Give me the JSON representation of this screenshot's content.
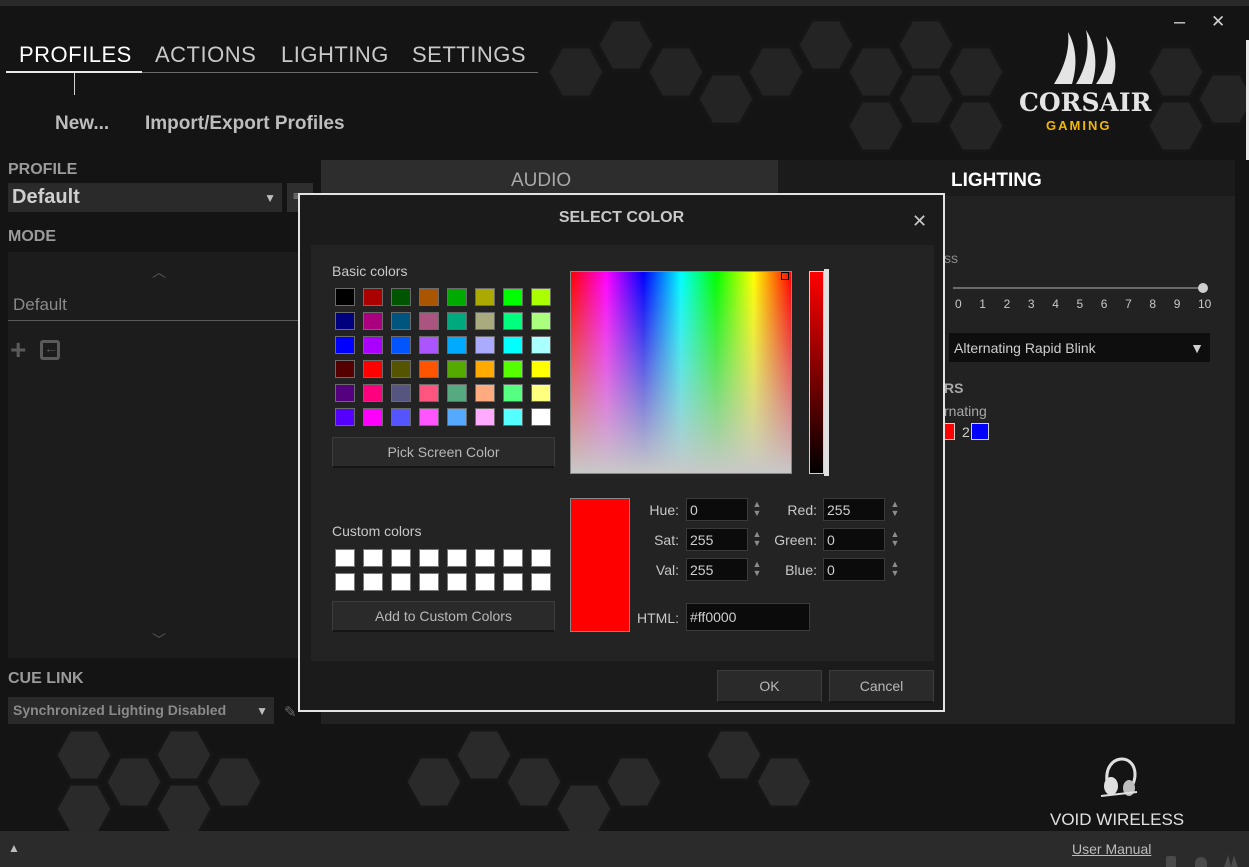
{
  "window": {
    "minimize_glyph": "–",
    "close_glyph": "✕"
  },
  "nav": {
    "tabs": [
      {
        "label": "PROFILES",
        "active": true
      },
      {
        "label": "ACTIONS",
        "active": false
      },
      {
        "label": "LIGHTING",
        "active": false
      },
      {
        "label": "SETTINGS",
        "active": false
      }
    ]
  },
  "profile_actions": {
    "new_label": "New...",
    "import_export_label": "Import/Export Profiles"
  },
  "brand": {
    "name": "CORSAIR",
    "sub": "GAMING",
    "accent": "#f2b705"
  },
  "left_panel": {
    "profile_label": "PROFILE",
    "profile_value": "Default",
    "mode_label": "MODE",
    "mode_item": "Default",
    "cue_link_label": "CUE LINK",
    "cue_link_value": "Synchronized Lighting Disabled"
  },
  "content": {
    "tab_audio": "AUDIO",
    "tab_lighting": "LIGHTING",
    "brightness_partial": "ss",
    "scale": [
      "0",
      "1",
      "2",
      "3",
      "4",
      "5",
      "6",
      "7",
      "8",
      "9",
      "10"
    ],
    "brightness_level": 10,
    "effect_value": "Alternating Rapid Blink",
    "colors_partial": "RS",
    "alternating_partial": "rnating",
    "color2_label": "2",
    "color1": "#ff0000",
    "color2": "#0000ff"
  },
  "dialog": {
    "title": "SELECT COLOR",
    "close_glyph": "✕",
    "basic_colors_label": "Basic colors",
    "basic_colors": [
      [
        "#000000",
        "#aa0000",
        "#005500",
        "#aa5500",
        "#00aa00",
        "#aaaa00",
        "#00ff00",
        "#aaff00"
      ],
      [
        "#00007f",
        "#aa007f",
        "#00557f",
        "#aa557f",
        "#00aa7f",
        "#aaaa7f",
        "#00ff7f",
        "#aaff7f"
      ],
      [
        "#0000ff",
        "#aa00ff",
        "#0055ff",
        "#aa55ff",
        "#00aaff",
        "#aaaaff",
        "#00ffff",
        "#aaffff"
      ],
      [
        "#550000",
        "#ff0000",
        "#555500",
        "#ff5500",
        "#55aa00",
        "#ffaa00",
        "#55ff00",
        "#ffff00"
      ],
      [
        "#55007f",
        "#ff007f",
        "#55557f",
        "#ff557f",
        "#55aa7f",
        "#ffaa7f",
        "#55ff7f",
        "#ffff7f"
      ],
      [
        "#5500ff",
        "#ff00ff",
        "#5555ff",
        "#ff55ff",
        "#55aaff",
        "#ffaaff",
        "#55ffff",
        "#ffffff"
      ]
    ],
    "pick_screen_label": "Pick Screen Color",
    "custom_colors_label": "Custom colors",
    "add_custom_label": "Add to Custom Colors",
    "preview_color": "#ff0000",
    "hue_label": "Hue:",
    "hue_value": "0",
    "sat_label": "Sat:",
    "sat_value": "255",
    "val_label": "Val:",
    "val_value": "255",
    "red_label": "Red:",
    "red_value": "255",
    "green_label": "Green:",
    "green_value": "0",
    "blue_label": "Blue:",
    "blue_value": "0",
    "html_label": "HTML:",
    "html_value": "#ff0000",
    "ok_label": "OK",
    "cancel_label": "Cancel"
  },
  "device": {
    "name": "VOID WIRELESS"
  },
  "footer": {
    "expand_glyph": "▲",
    "user_manual": "User Manual"
  }
}
